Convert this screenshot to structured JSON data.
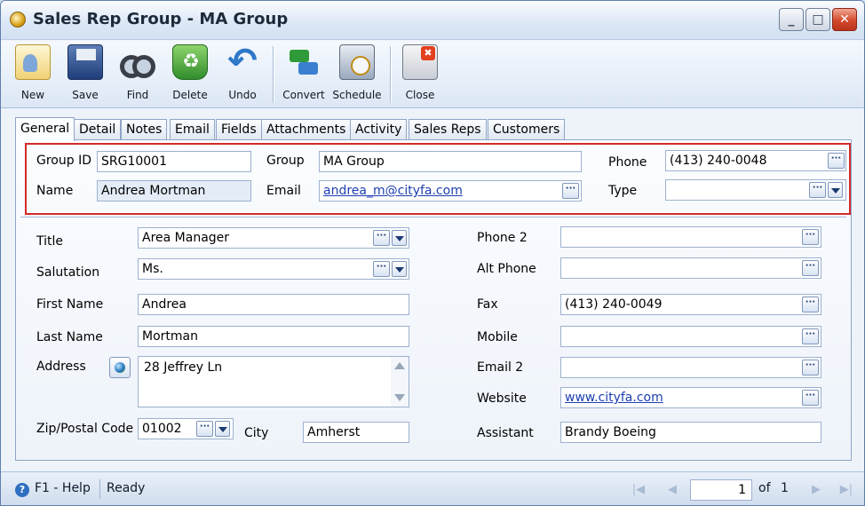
{
  "window": {
    "title": "Sales Rep Group - MA Group"
  },
  "toolbar": {
    "new": "New",
    "save": "Save",
    "find": "Find",
    "delete": "Delete",
    "undo": "Undo",
    "convert": "Convert",
    "schedule": "Schedule",
    "close": "Close"
  },
  "tabs": [
    "General",
    "Detail",
    "Notes",
    "Email",
    "Fields",
    "Attachments",
    "Activity",
    "Sales Reps",
    "Customers"
  ],
  "header": {
    "group_id_label": "Group ID",
    "group_id_value": "SRG10001",
    "group_label": "Group",
    "group_value": "MA Group",
    "phone_label": "Phone",
    "phone_value": "(413) 240-0048",
    "name_label": "Name",
    "name_value": "Andrea Mortman",
    "email_label": "Email",
    "email_value": "andrea_m@cityfa.com",
    "type_label": "Type",
    "type_value": ""
  },
  "form": {
    "title_label": "Title",
    "title_value": "Area Manager",
    "salutation_label": "Salutation",
    "salutation_value": "Ms.",
    "first_name_label": "First Name",
    "first_name_value": "Andrea",
    "last_name_label": "Last Name",
    "last_name_value": "Mortman",
    "address_label": "Address",
    "address_value": "28 Jeffrey Ln",
    "zip_label": "Zip/Postal Code",
    "zip_value": "01002",
    "city_label": "City",
    "city_value": "Amherst",
    "phone2_label": "Phone 2",
    "phone2_value": "",
    "alt_phone_label": "Alt Phone",
    "alt_phone_value": "",
    "fax_label": "Fax",
    "fax_value": "(413) 240-0049",
    "mobile_label": "Mobile",
    "mobile_value": "",
    "email2_label": "Email 2",
    "email2_value": "",
    "website_label": "Website",
    "website_value": "www.cityfa.com",
    "assistant_label": "Assistant",
    "assistant_value": "Brandy Boeing"
  },
  "status": {
    "help": "F1 - Help",
    "state": "Ready",
    "page_current": "1",
    "page_of": "of",
    "page_total": "1"
  },
  "icons": {
    "ellipsis": "···"
  }
}
